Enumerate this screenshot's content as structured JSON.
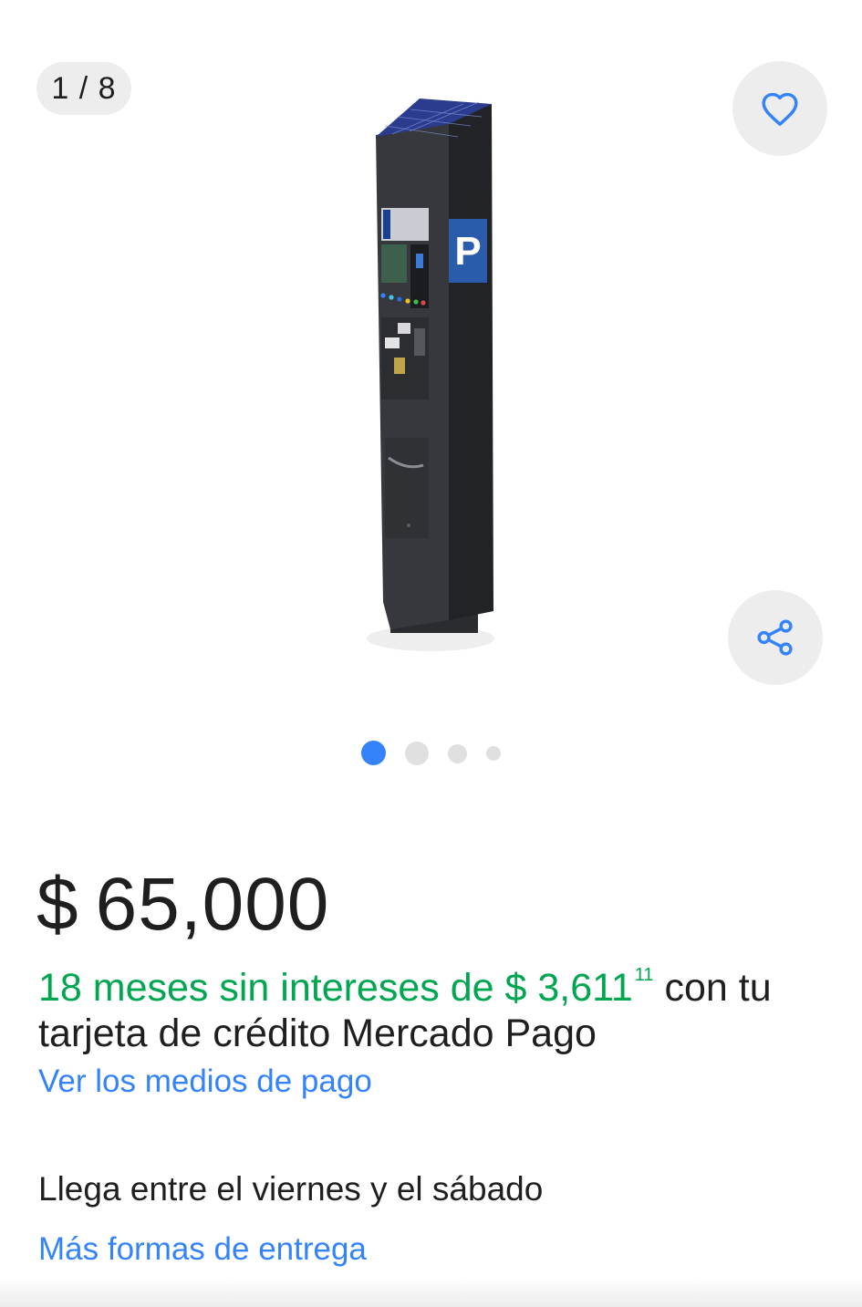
{
  "gallery": {
    "counter": "1 / 8",
    "dots": {
      "total": 4,
      "active_index": 0
    },
    "image": {
      "alt": "Parquímetro",
      "panel_letter": "P",
      "colors": {
        "body": "#2b2d31",
        "panel": "#2a5cab",
        "solar": "#2a3b8f"
      }
    },
    "favorite_icon": "heart-outline-icon",
    "share_icon": "share-icon"
  },
  "price": {
    "currency": "$",
    "amount": "65,000"
  },
  "installments": {
    "highlight": "18 meses sin intereses de $ 3,611",
    "cents": "11",
    "rest_line1": " con tu",
    "rest_line2": "tarjeta de crédito Mercado Pago"
  },
  "payment_link": "Ver los medios de pago",
  "shipping": {
    "arrival": "Llega entre el viernes y el sábado",
    "more_link": "Más formas de entrega"
  },
  "colors": {
    "accent": "#3483fa",
    "green": "#00a650",
    "text": "#1f1f1f",
    "chip_bg": "#ededed"
  }
}
